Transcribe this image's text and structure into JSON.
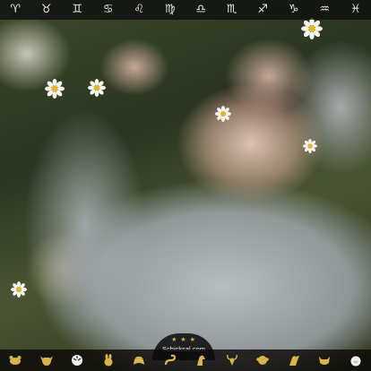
{
  "photo": {
    "subject": "woman-lying-on-grass-with-daisies",
    "colors": {
      "grass": "#2f3a22",
      "sweater": "#b9bec4",
      "skin": "#e2c0ae",
      "hair": "#2a1d16",
      "daisy": "#f5f5f0",
      "daisy_center": "#e6b62a"
    }
  },
  "zodiac_bar": {
    "items": [
      {
        "glyph": "♈",
        "name": "aries-icon"
      },
      {
        "glyph": "♉",
        "name": "taurus-icon"
      },
      {
        "glyph": "♊",
        "name": "gemini-icon"
      },
      {
        "glyph": "♋",
        "name": "cancer-icon"
      },
      {
        "glyph": "♌",
        "name": "leo-icon"
      },
      {
        "glyph": "♍",
        "name": "virgo-icon"
      },
      {
        "glyph": "♎",
        "name": "libra-icon"
      },
      {
        "glyph": "♏",
        "name": "scorpio-icon"
      },
      {
        "glyph": "♐",
        "name": "sagittarius-icon"
      },
      {
        "glyph": "♑",
        "name": "capricorn-icon"
      },
      {
        "glyph": "♒",
        "name": "aquarius-icon"
      },
      {
        "glyph": "♓",
        "name": "pisces-icon"
      }
    ]
  },
  "chinese_zodiac_bar": {
    "icons": [
      "rat-icon",
      "ox-icon",
      "tiger-icon",
      "rabbit-icon",
      "dragon-icon",
      "snake-icon",
      "horse-icon",
      "goat-icon",
      "monkey-icon",
      "rooster-icon",
      "dog-icon",
      "pig-icon"
    ],
    "accent_color": "#d9b44a"
  },
  "logo": {
    "brand": "Schicksal.com"
  }
}
